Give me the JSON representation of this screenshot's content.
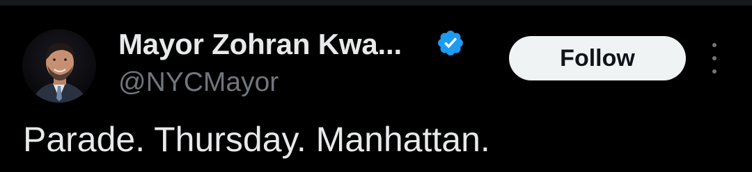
{
  "author": {
    "display_name": "Mayor Zohran Kwa...",
    "handle": "@NYCMayor",
    "verified": true,
    "avatar": "profile-photo"
  },
  "actions": {
    "follow_label": "Follow",
    "more_icon": "more-vertical-icon"
  },
  "tweet": {
    "text": "Parade. Thursday. Manhattan."
  },
  "colors": {
    "background": "#000000",
    "primary_text": "#e7e9ea",
    "secondary_text": "#71767b",
    "verified_badge": "#1d9bf0",
    "follow_button_bg": "#eff3f4",
    "follow_button_text": "#0f1419"
  }
}
